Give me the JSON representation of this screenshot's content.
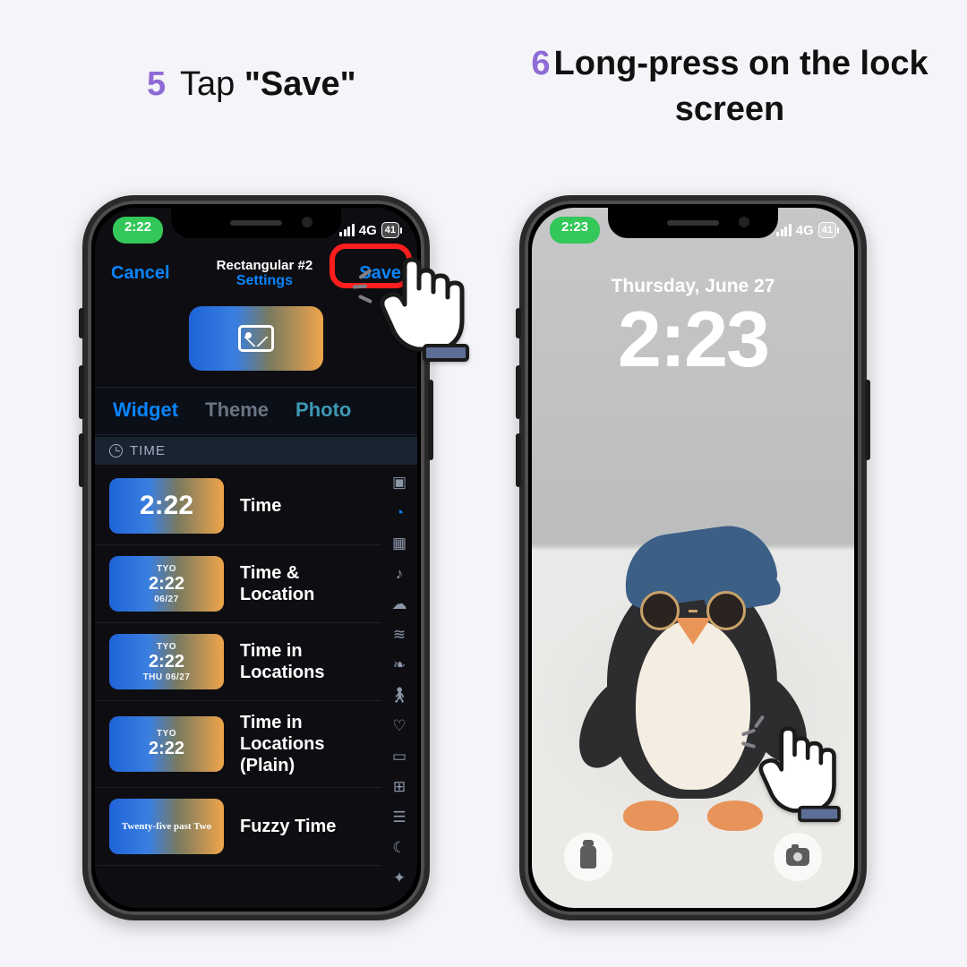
{
  "captions": {
    "step5_num": "5",
    "step5_prefix": "Tap ",
    "step5_bold": "\"Save\"",
    "step6_num": "6",
    "step6_text": "Long-press on the lock screen"
  },
  "status": {
    "left_time": "2:22",
    "right_time": "2:23",
    "network": "4G",
    "battery": "41"
  },
  "settings": {
    "cancel": "Cancel",
    "title": "Rectangular #2",
    "subtitle": "Settings",
    "save": "Save",
    "tabs": {
      "widget": "Widget",
      "theme": "Theme",
      "photo": "Photo"
    },
    "section": "TIME",
    "rows": [
      {
        "label": "Time",
        "big": "2:22"
      },
      {
        "label": "Time & Location",
        "top": "TYO",
        "mid": "2:22",
        "bot": "06/27"
      },
      {
        "label": "Time in Locations",
        "top": "TYO",
        "mid": "2:22",
        "bot": "THU 06/27"
      },
      {
        "label": "Time in Locations (Plain)",
        "top": "TYO",
        "mid": "2:22"
      },
      {
        "label": "Fuzzy Time",
        "fuzzy": "Twenty-five past Two"
      }
    ]
  },
  "lockscreen": {
    "date": "Thursday, June 27",
    "time": "2:23"
  }
}
